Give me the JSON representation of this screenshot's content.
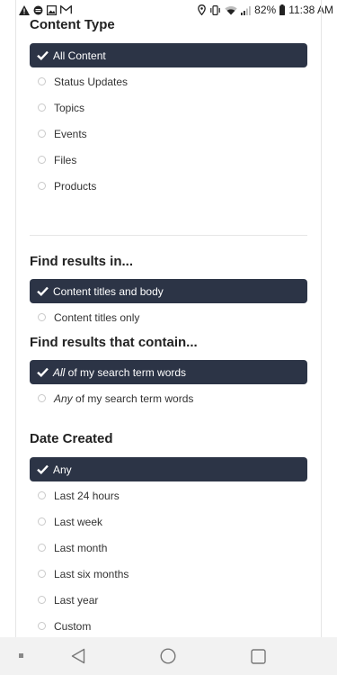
{
  "status_bar": {
    "left_icons": [
      "warning-icon",
      "sync-icon",
      "image-icon",
      "gmail-icon"
    ],
    "right_icons": [
      "location-icon",
      "vibrate-icon",
      "wifi-icon",
      "signal-icon",
      "battery-icon"
    ],
    "battery": "82%",
    "time": "11:38 AM"
  },
  "content_type": {
    "title": "Content Type",
    "options": [
      {
        "label": "All Content",
        "selected": true
      },
      {
        "label": "Status Updates",
        "selected": false
      },
      {
        "label": "Topics",
        "selected": false
      },
      {
        "label": "Events",
        "selected": false
      },
      {
        "label": "Files",
        "selected": false
      },
      {
        "label": "Products",
        "selected": false
      }
    ]
  },
  "find_in": {
    "title": "Find results in...",
    "options": [
      {
        "label": "Content titles and body",
        "selected": true
      },
      {
        "label": "Content titles only",
        "selected": false
      }
    ]
  },
  "find_contain": {
    "title": "Find results that contain...",
    "options": [
      {
        "emphasis": "All",
        "rest": " of my search term words",
        "selected": true
      },
      {
        "emphasis": "Any",
        "rest": " of my search term words",
        "selected": false
      }
    ]
  },
  "date_created": {
    "title": "Date Created",
    "options": [
      {
        "label": "Any",
        "selected": true
      },
      {
        "label": "Last 24 hours",
        "selected": false
      },
      {
        "label": "Last week",
        "selected": false
      },
      {
        "label": "Last month",
        "selected": false
      },
      {
        "label": "Last six months",
        "selected": false
      },
      {
        "label": "Last year",
        "selected": false
      },
      {
        "label": "Custom",
        "selected": false
      }
    ]
  },
  "colors": {
    "selected_bg": "#2c3446",
    "selected_text": "#ffffff",
    "text": "#333333",
    "nav_bg": "#f2f2f2"
  },
  "navigation": {
    "buttons": [
      "recents-dot-icon",
      "back-icon",
      "home-icon",
      "overview-icon"
    ]
  }
}
